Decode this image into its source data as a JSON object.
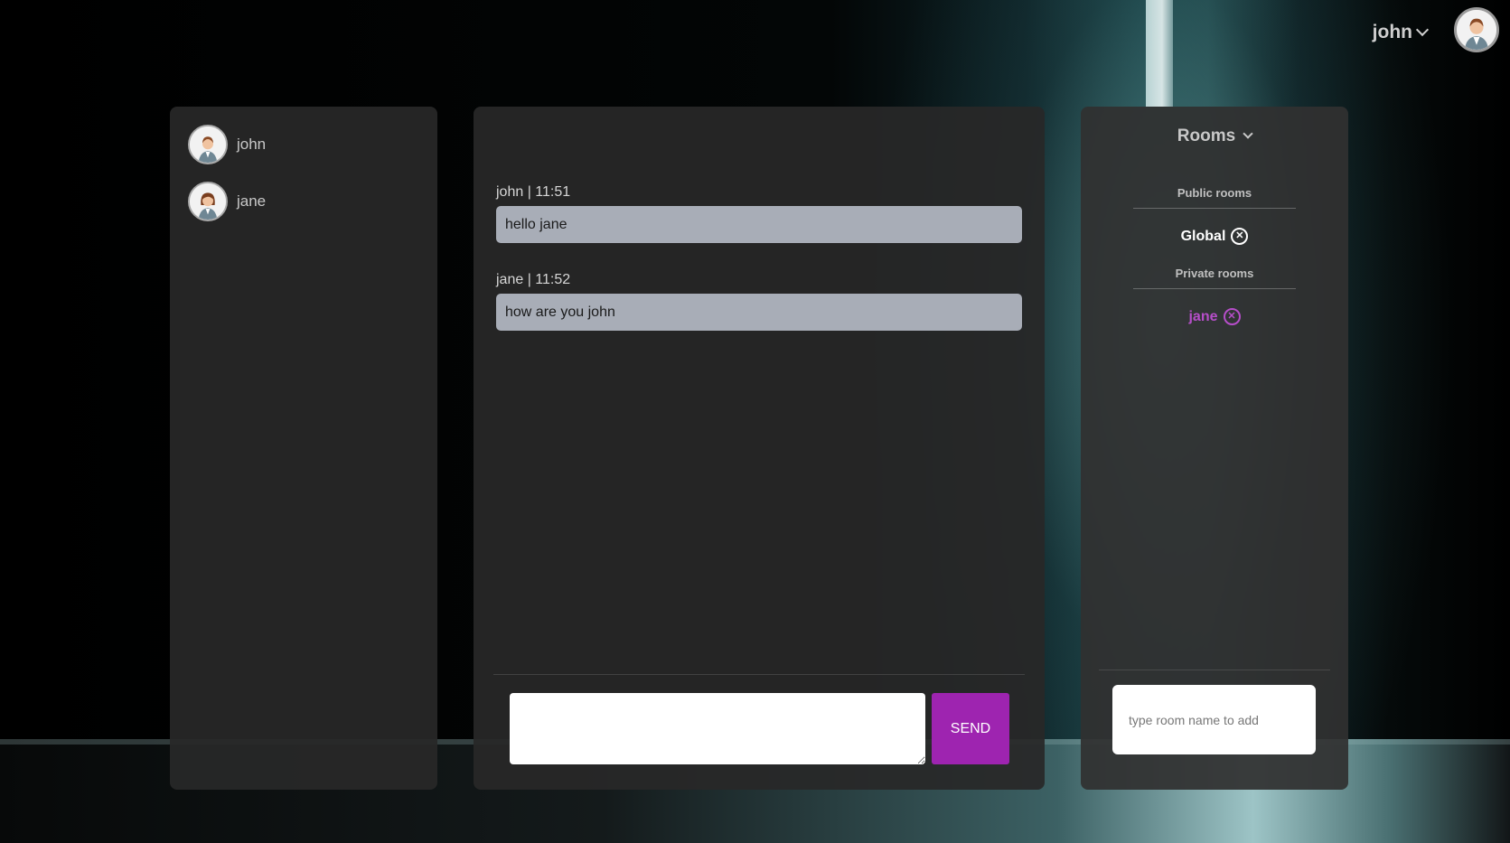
{
  "header": {
    "current_user": "john"
  },
  "users": [
    {
      "name": "john"
    },
    {
      "name": "jane"
    }
  ],
  "chat": {
    "messages": [
      {
        "meta": "john | 11:51",
        "text": "hello jane"
      },
      {
        "meta": "jane | 11:52",
        "text": "how are you john"
      }
    ],
    "input_value": "",
    "send_label": "SEND"
  },
  "rooms": {
    "title": "Rooms",
    "public_title": "Public rooms",
    "public": [
      {
        "name": "Global"
      }
    ],
    "private_title": "Private rooms",
    "private": [
      {
        "name": "jane"
      }
    ],
    "add_placeholder": "type room name to add",
    "close_glyph": "✕"
  },
  "colors": {
    "accent": "#9e24b0",
    "private_room": "#b64ec9",
    "bubble": "#a8adb7",
    "panel": "#282828"
  },
  "icons": [
    "chevron-down-icon",
    "avatar-icon",
    "close-circle-icon"
  ]
}
